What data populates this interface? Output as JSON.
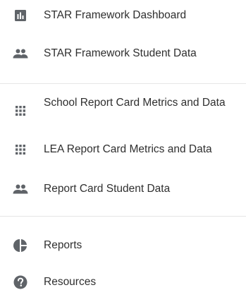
{
  "colors": {
    "icon": "#5f6368",
    "text": "#2f2f2f",
    "divider": "#e6e6e6"
  },
  "nav": {
    "items": [
      {
        "label": "STAR Framework Dashboard",
        "icon": "bar-chart-icon"
      },
      {
        "label": "STAR Framework Student Data",
        "icon": "people-icon"
      },
      {
        "label": "School Report Card Metrics and Data",
        "icon": "grid-icon"
      },
      {
        "label": "LEA Report Card Metrics and Data",
        "icon": "grid-icon"
      },
      {
        "label": "Report Card Student Data",
        "icon": "people-icon"
      },
      {
        "label": "Reports",
        "icon": "pie-chart-icon"
      },
      {
        "label": "Resources",
        "icon": "help-icon"
      }
    ]
  }
}
